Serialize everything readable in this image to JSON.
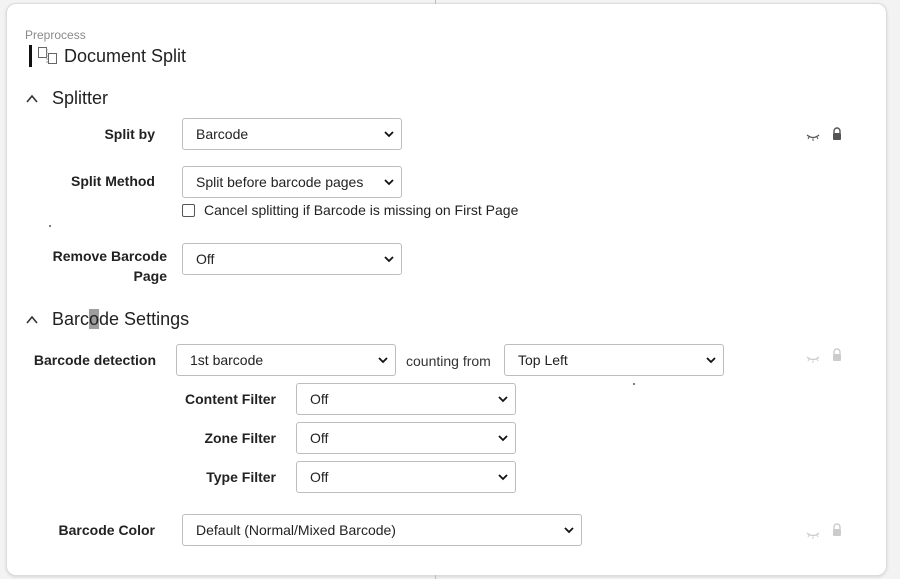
{
  "header": {
    "breadcrumb": "Preprocess",
    "title": "Document Split"
  },
  "splitter": {
    "title": "Splitter",
    "split_by": {
      "label": "Split by",
      "value": "Barcode"
    },
    "split_method": {
      "label": "Split Method",
      "value": "Split before barcode pages"
    },
    "cancel_checkbox": {
      "label": "Cancel splitting if Barcode is missing on First Page",
      "checked": false
    },
    "remove_barcode_page": {
      "label_line1": "Remove Barcode",
      "label_line2": "Page",
      "value": "Off"
    }
  },
  "barcode_settings": {
    "title_part1": "Barc",
    "title_highlight": "o",
    "title_part2": "de Settings",
    "detection": {
      "label": "Barcode detection",
      "value": "1st barcode",
      "counting_text": "counting from",
      "counting_value": "Top Left"
    },
    "content_filter": {
      "label": "Content Filter",
      "value": "Off"
    },
    "zone_filter": {
      "label": "Zone Filter",
      "value": "Off"
    },
    "type_filter": {
      "label": "Type Filter",
      "value": "Off"
    },
    "barcode_color": {
      "label": "Barcode Color",
      "value": "Default (Normal/Mixed Barcode)"
    }
  },
  "icons": {
    "visibility": "eye-closed-icon",
    "lock": "lock-icon",
    "chevron": "chevron-up-icon",
    "dropdown": "chevron-down-icon"
  },
  "colors": {
    "card_border": "#dcdcdc",
    "select_border": "#bdbdbd",
    "text": "#222222",
    "muted": "#8a8a8a"
  }
}
